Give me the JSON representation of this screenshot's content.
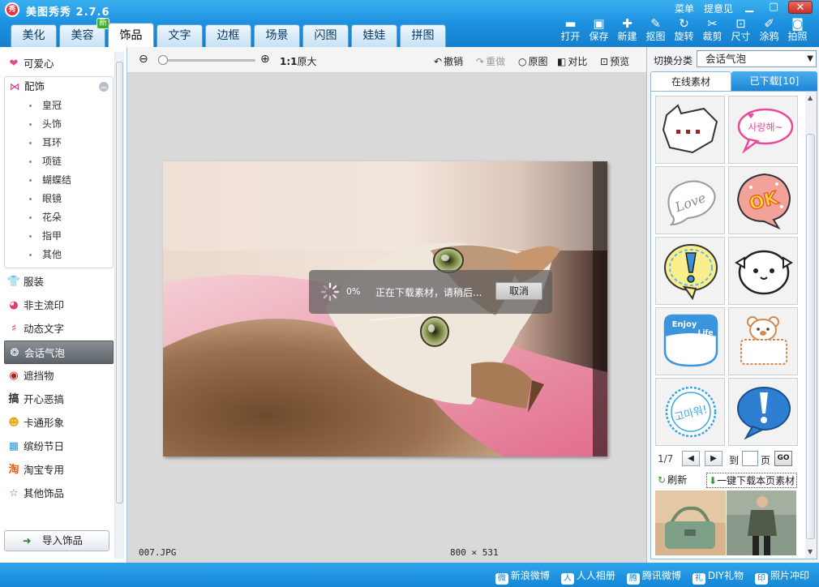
{
  "app": {
    "logo_text": "秀",
    "title": "美图秀秀 2.7.6",
    "menu_label": "菜单",
    "feedback_label": "提意见"
  },
  "main_tabs": [
    {
      "label": "美化"
    },
    {
      "label": "美容",
      "badge": "新"
    },
    {
      "label": "饰品",
      "active": true
    },
    {
      "label": "文字"
    },
    {
      "label": "边框"
    },
    {
      "label": "场景"
    },
    {
      "label": "闪图"
    },
    {
      "label": "娃娃"
    },
    {
      "label": "拼图"
    }
  ],
  "toolbar": {
    "open": "打开",
    "save": "保存",
    "new": "新建",
    "cutout": "抠图",
    "rotate": "旋转",
    "crop": "裁剪",
    "size": "尺寸",
    "doodle": "涂鸦",
    "camera": "拍照"
  },
  "sidebar": {
    "cute": "可爱心",
    "accessories": "配饰",
    "sub_items": [
      "皇冠",
      "头饰",
      "耳环",
      "项链",
      "蝴蝶结",
      "眼镜",
      "花朵",
      "指甲",
      "其他"
    ],
    "items": [
      {
        "label": "服装",
        "icon": "shirt-icon"
      },
      {
        "label": "非主流印",
        "icon": "lips-icon"
      },
      {
        "label": "动态文字",
        "icon": "text-icon"
      },
      {
        "label": "会话气泡",
        "icon": "speech-bubble-icon",
        "active": true
      },
      {
        "label": "遮挡物",
        "icon": "mask-icon"
      },
      {
        "label": "开心恶搞",
        "icon": "prank-icon"
      },
      {
        "label": "卡通形象",
        "icon": "cartoon-icon"
      },
      {
        "label": "缤纷节日",
        "icon": "gift-icon"
      },
      {
        "label": "淘宝专用",
        "icon": "taobao-icon"
      },
      {
        "label": "其他饰品",
        "icon": "star-icon"
      }
    ],
    "import_button": "导入饰品"
  },
  "canvas": {
    "zoom_ratio": "1:1",
    "original_size": "原大",
    "undo": "撤销",
    "redo": "重做",
    "original": "原图",
    "compare": "对比",
    "preview": "预览",
    "loading_percent": "0%",
    "loading_text": "正在下载素材，请稍后...",
    "cancel": "取消",
    "filename": "007.JPG",
    "dimensions": "800 × 531"
  },
  "right_panel": {
    "switch_label": "切换分类",
    "selected_category": "会话气泡",
    "tab_online": "在线素材",
    "tab_downloaded": "已下载[10]",
    "page_info": "1/7",
    "goto_label": "到",
    "page_suffix": "页",
    "go_button": "GO",
    "refresh": "刷新",
    "download_page": "一键下载本页素材",
    "bubble_texts": {
      "saranghae": "사랑해~",
      "love": "Love",
      "ok": "OK",
      "enjoy": "Enjoy",
      "life": "Life",
      "gomawo": "고마워!"
    }
  },
  "share": {
    "sina": "新浪微博",
    "renren": "人人相册",
    "tencent": "腾讯微博",
    "diy": "DIY礼物",
    "photo_print": "照片冲印"
  },
  "colors": {
    "title_blue": "#1e93e0",
    "active_category": "#6a7176",
    "bubble_pink": "#e94b9a",
    "bubble_blue": "#3a95dc",
    "ok_orange": "#ef5b2e"
  }
}
